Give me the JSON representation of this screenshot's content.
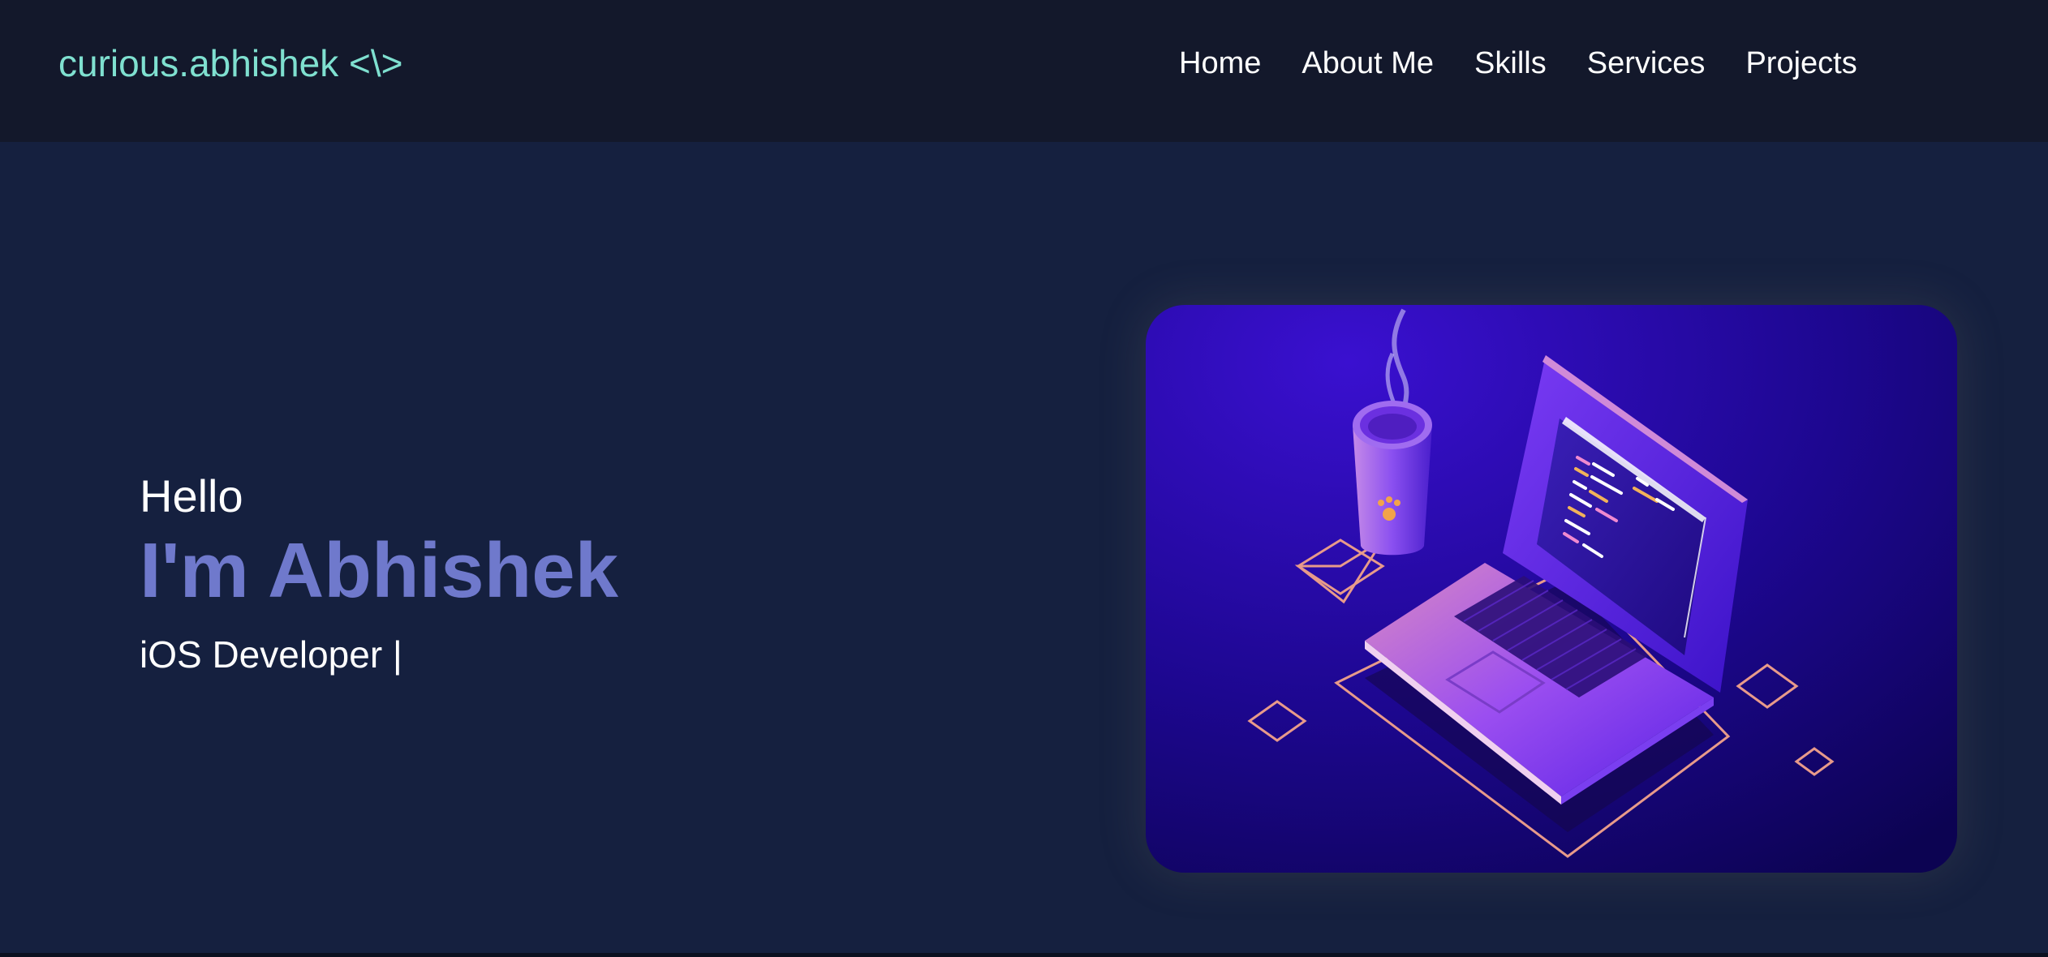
{
  "brand": {
    "logo_text": "curious.abhishek <\\>"
  },
  "nav": {
    "items": [
      {
        "label": "Home"
      },
      {
        "label": "About Me"
      },
      {
        "label": "Skills"
      },
      {
        "label": "Services"
      },
      {
        "label": "Projects"
      }
    ]
  },
  "hero": {
    "greeting": "Hello",
    "headline": "I'm Abhishek",
    "subtitle": "iOS Developer |",
    "illustration": "isometric-laptop-and-coffee-cup"
  },
  "colors": {
    "nav_bg": "#13182b",
    "page_bg": "#15203f",
    "brand": "#7fe0d0",
    "headline": "#6f79cc",
    "illustration_bg": "#2a0bb8"
  }
}
